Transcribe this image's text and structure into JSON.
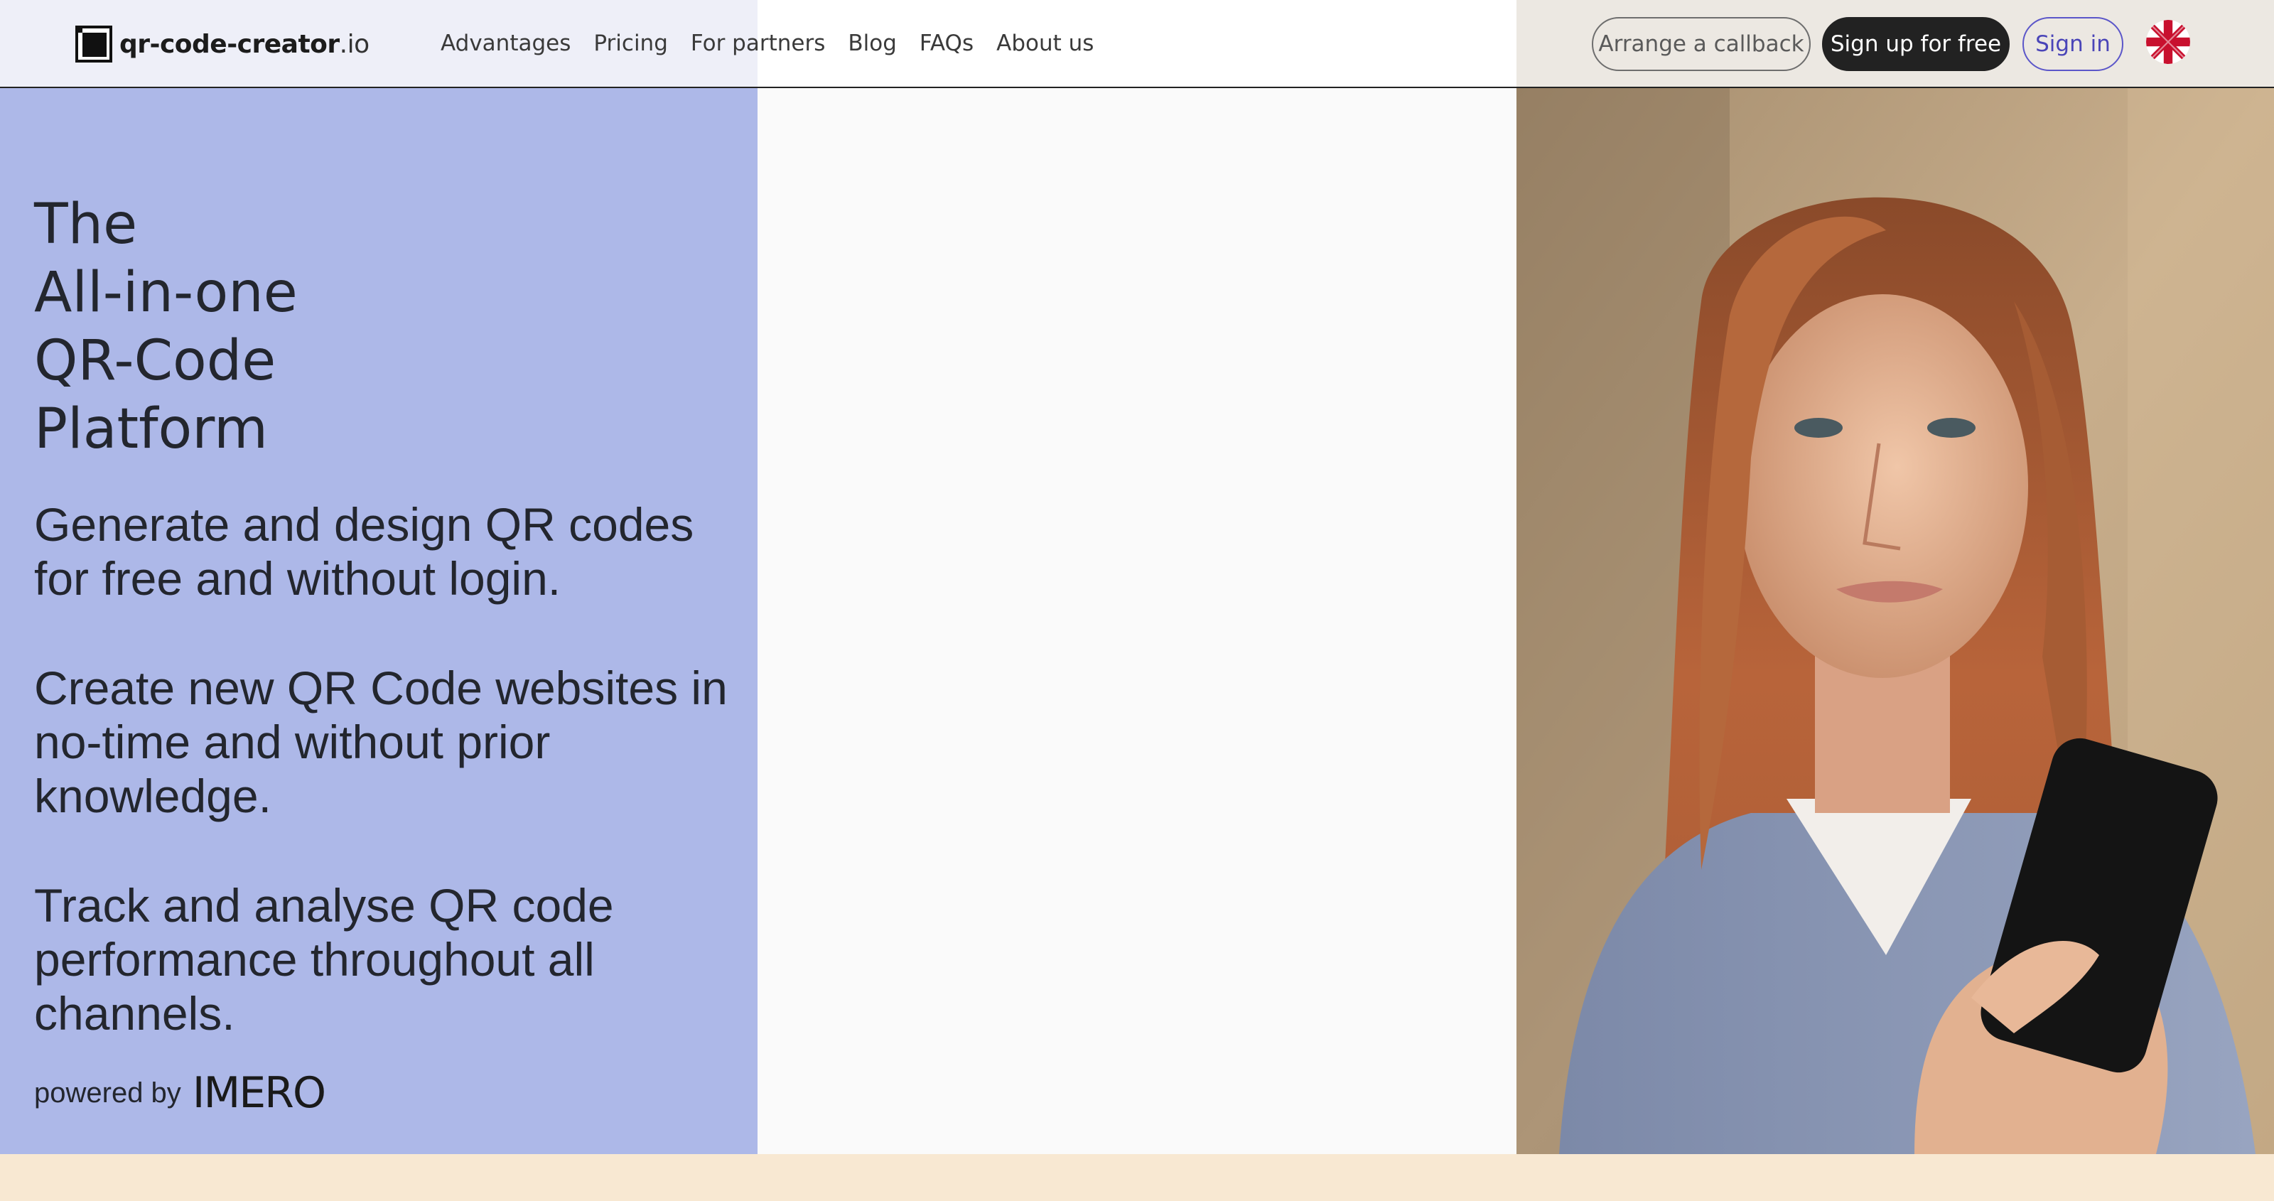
{
  "brand": {
    "name_bold": "qr-code-creator",
    "name_suffix": ".io"
  },
  "nav": {
    "links": [
      "Advantages",
      "Pricing",
      "For partners",
      "Blog",
      "FAQs",
      "About us"
    ],
    "callback_label": "Arrange a callback",
    "signup_label": "Sign up for free",
    "signin_label": "Sign in",
    "language_icon": "uk-flag-icon"
  },
  "hero": {
    "title_lines": [
      "The",
      "All-in-one",
      "QR-Code",
      "Platform"
    ],
    "paragraphs": [
      "Generate and design QR codes for free and without login.",
      "Create new QR Code websites in no-time and without prior knowledge.",
      "Track and analyse QR code performance throughout all channels."
    ],
    "powered_by": "powered by",
    "partner_logo": "IMERO"
  },
  "colors": {
    "hero_left_bg": "#adb8e8",
    "hero_mid_bg": "#fafafa",
    "bottom_strip": "#f8e8d2",
    "signup_bg": "#222222",
    "signin_accent": "#4a45b8"
  }
}
